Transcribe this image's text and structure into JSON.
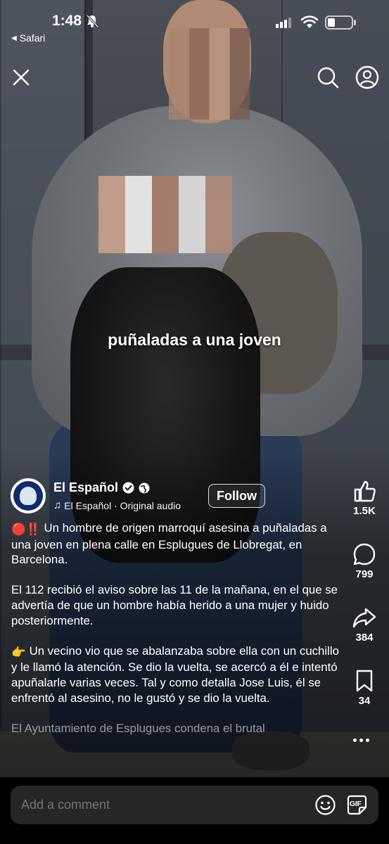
{
  "status_bar": {
    "time": "1:48",
    "back_app": "Safari",
    "battery_level_percent": 30
  },
  "top_bar": {
    "close_icon": "close-icon",
    "search_icon": "search-icon",
    "profile_icon": "profile-icon"
  },
  "video": {
    "caption": "puñaladas a una joven"
  },
  "author": {
    "name": "El Español",
    "audio": "El Español · Original audio",
    "follow_label": "Follow"
  },
  "description": {
    "p1_emoji": "🔴‼️",
    "p1": " Un hombre de origen marroquí asesina a puñaladas a una joven en plena calle en Esplugues de Llobregat, en Barcelona.",
    "p2": "El 112 recibió el aviso sobre las 11 de la mañana, en el que se advertía de que un hombre había herido a una mujer y huido posteriormente.",
    "p3_emoji": "👉",
    "p3": " Un vecino vio que se abalanzaba sobre ella con un cuchillo y le llamó la atención. Se dio la vuelta, se acercó a él e intentó apuñalarle varias veces. Tal y como detalla Jose Luis, él se enfrentó al asesino, no le gustó y se dio la vuelta.",
    "p4": "El Ayuntamiento de Esplugues condena el brutal"
  },
  "actions": {
    "likes": "1.5K",
    "comments": "799",
    "shares": "384",
    "saves": "34"
  },
  "comment_bar": {
    "placeholder": "Add a comment",
    "gif_label": "GIF"
  },
  "colors": {
    "comment_box": "#262626",
    "avatar_bg": "#0b2d6b",
    "alert_red": "#e0241b"
  }
}
